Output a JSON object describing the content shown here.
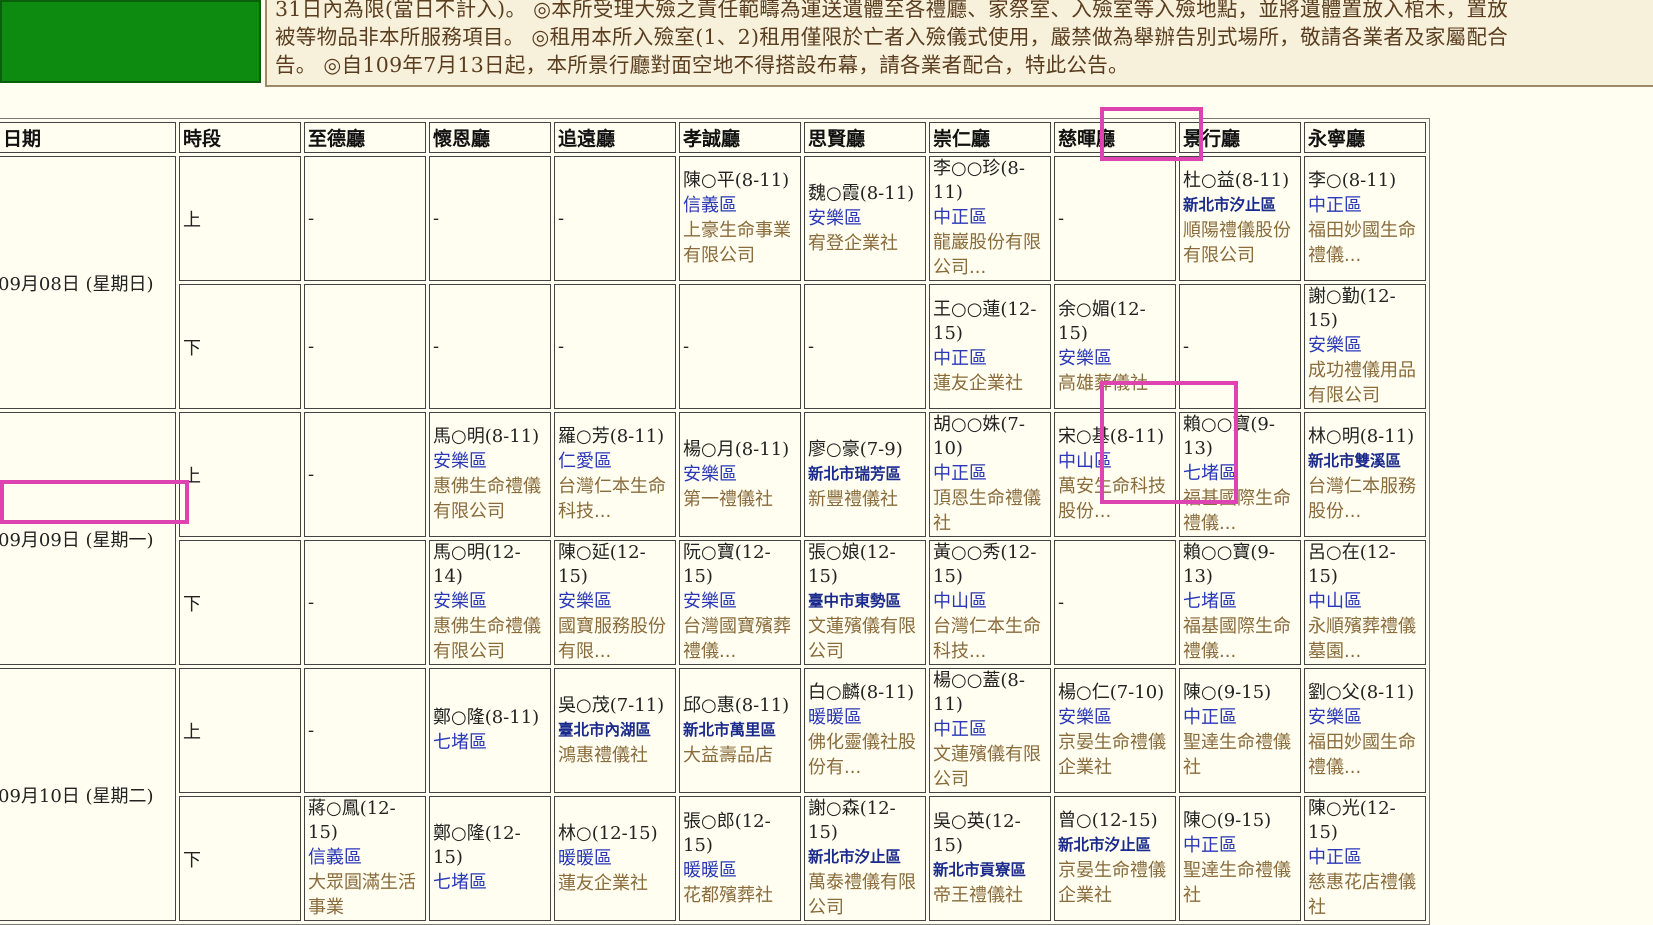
{
  "notice": {
    "line1": "31日內為限(當日不計入)。 ◎本所受理大殮之責任範疇為運送遺體至各禮廳、家祭室、入殮室等入殮地點，並將遺體置放入棺木，置放",
    "line2": "被等物品非本所服務項目。 ◎租用本所入殮室(1、2)租用僅限於亡者入殮儀式使用，嚴禁做為舉辦告別式場所，敬請各業者及家屬配合",
    "line3": "告。 ◎自109年7月13日起，本所景行廳對面空地不得搭設布幕，請各業者配合，特此公告。"
  },
  "headers": {
    "date": "日期",
    "slot": "時段",
    "h1": "至德廳",
    "h2": "懷恩廳",
    "h3": "追遠廳",
    "h4": "孝誠廳",
    "h5": "思賢廳",
    "h6": "崇仁廳",
    "h7": "慈暉廳",
    "h8": "景行廳",
    "h9": "永寧廳"
  },
  "dash": "-",
  "days": [
    {
      "date": "09月08日 (星期日)",
      "am": "上",
      "pm": "下",
      "am_cells": [
        null,
        null,
        null,
        {
          "name": "陳○平(8-11)",
          "district": "信義區",
          "company": "上豪生命事業有限公司"
        },
        {
          "name": "魏○霞(8-11)",
          "district": "安樂區",
          "company": "宥登企業社"
        },
        {
          "name": "李○○珍(8-11)",
          "district": "中正區",
          "company": "龍巖股份有限公司..."
        },
        null,
        {
          "name": "杜○益(8-11)",
          "district": "新北市汐止區",
          "company": "順陽禮儀股份有限公司"
        },
        {
          "name": "李○(8-11)",
          "district": "中正區",
          "company": "福田妙國生命禮儀..."
        }
      ],
      "pm_cells": [
        null,
        null,
        null,
        null,
        null,
        {
          "name": "王○○蓮(12-15)",
          "district": "中正區",
          "company": "蓮友企業社"
        },
        {
          "name": "余○媚(12-15)",
          "district": "安樂區",
          "company": "高雄葬儀社"
        },
        null,
        {
          "name": "謝○勤(12-15)",
          "district": "安樂區",
          "company": "成功禮儀用品有限公司"
        }
      ]
    },
    {
      "date": "09月09日 (星期一)",
      "am": "上",
      "pm": "下",
      "am_cells": [
        null,
        {
          "name": "馬○明(8-11)",
          "district": "安樂區",
          "company": "惠佛生命禮儀有限公司"
        },
        {
          "name": "羅○芳(8-11)",
          "district": "仁愛區",
          "company": "台灣仁本生命科技..."
        },
        {
          "name": "楊○月(8-11)",
          "district": "安樂區",
          "company": "第一禮儀社"
        },
        {
          "name": "廖○豪(7-9)",
          "district": "新北市瑞芳區",
          "company": "新豐禮儀社"
        },
        {
          "name": "胡○○姝(7-10)",
          "district": "中正區",
          "company": "頂恩生命禮儀社"
        },
        {
          "name": "宋○基(8-11)",
          "district": "中山區",
          "company": "萬安生命科技股份..."
        },
        {
          "name": "賴○○寶(9-13)",
          "district": "七堵區",
          "company": "福基國際生命禮儀..."
        },
        {
          "name": "林○明(8-11)",
          "district": "新北市雙溪區",
          "company": "台灣仁本服務股份..."
        }
      ],
      "pm_cells": [
        null,
        {
          "name": "馬○明(12-14)",
          "district": "安樂區",
          "company": "惠佛生命禮儀有限公司"
        },
        {
          "name": "陳○延(12-15)",
          "district": "安樂區",
          "company": "國寶服務股份有限..."
        },
        {
          "name": "阮○寶(12-15)",
          "district": "安樂區",
          "company": "台灣國寶殯葬禮儀..."
        },
        {
          "name": "張○娘(12-15)",
          "district": "臺中市東勢區",
          "company": "文蓮殯儀有限公司"
        },
        {
          "name": "黃○○秀(12-15)",
          "district": "中山區",
          "company": "台灣仁本生命科技..."
        },
        null,
        {
          "name": "賴○○寶(9-13)",
          "district": "七堵區",
          "company": "福基國際生命禮儀..."
        },
        {
          "name": "呂○在(12-15)",
          "district": "中山區",
          "company": "永順殯葬禮儀墓園..."
        }
      ]
    },
    {
      "date": "09月10日 (星期二)",
      "am": "上",
      "pm": "下",
      "am_cells": [
        null,
        {
          "name": "鄭○隆(8-11)",
          "district": "七堵區",
          "company": ""
        },
        {
          "name": "吳○茂(7-11)",
          "district": "臺北市內湖區",
          "company": "鴻惠禮儀社"
        },
        {
          "name": "邱○惠(8-11)",
          "district": "新北市萬里區",
          "company": "大益壽品店"
        },
        {
          "name": "白○麟(8-11)",
          "district": "暖暖區",
          "company": "佛化靈儀社股份有..."
        },
        {
          "name": "楊○○蓋(8-11)",
          "district": "中正區",
          "company": "文蓮殯儀有限公司"
        },
        {
          "name": "楊○仁(7-10)",
          "district": "安樂區",
          "company": "京晏生命禮儀企業社"
        },
        {
          "name": "陳○(9-15)",
          "district": "中正區",
          "company": "聖達生命禮儀社"
        },
        {
          "name": "劉○父(8-11)",
          "district": "安樂區",
          "company": "福田妙國生命禮儀..."
        }
      ],
      "pm_cells": [
        {
          "name": "蔣○鳳(12-15)",
          "district": "信義區",
          "company": "大眾圓滿生活事業"
        },
        {
          "name": "鄭○隆(12-15)",
          "district": "七堵區",
          "company": ""
        },
        {
          "name": "林○(12-15)",
          "district": "暖暖區",
          "company": "蓮友企業社"
        },
        {
          "name": "張○郎(12-15)",
          "district": "暖暖區",
          "company": "花都殯葬社"
        },
        {
          "name": "謝○森(12-15)",
          "district": "新北市汐止區",
          "company": "萬泰禮儀有限公司"
        },
        {
          "name": "吳○英(12-15)",
          "district": "新北市貢寮區",
          "company": "帝王禮儀社"
        },
        {
          "name": "曾○(12-15)",
          "district": "新北市汐止區",
          "company": "京晏生命禮儀企業社"
        },
        {
          "name": "陳○(9-15)",
          "district": "中正區",
          "company": "聖達生命禮儀社"
        },
        {
          "name": "陳○光(12-15)",
          "district": "中正區",
          "company": "慈惠花店禮儀社"
        }
      ]
    }
  ]
}
